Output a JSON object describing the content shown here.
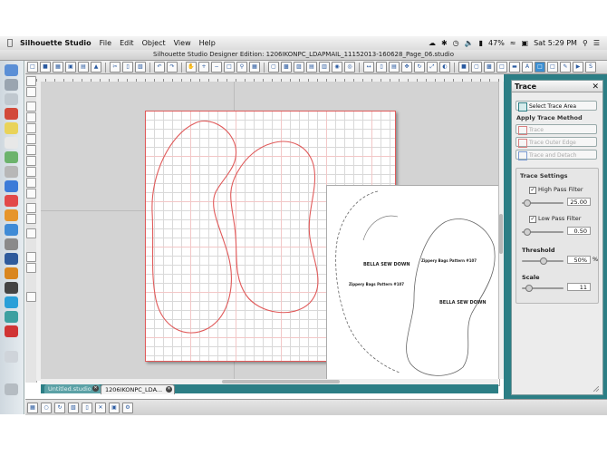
{
  "menubar": {
    "app_name": "Silhouette Studio",
    "menus": [
      "File",
      "Edit",
      "Object",
      "View",
      "Help"
    ],
    "battery": "47%",
    "clock": "Sat 5:29 PM"
  },
  "window": {
    "title": "Silhouette Studio Designer Edition: 1206IKONPC_LDAPMAIL_11152013-160628_Page_06.studio"
  },
  "tabs": [
    {
      "label": "Untitled.studio"
    },
    {
      "label": "1206IKONPC_LDA..."
    }
  ],
  "pattern_text": {
    "logo": "BELLA SEW DOWN",
    "pattern_a": "Zippery Bags Pattern #107",
    "pattern_b": "Zippery Bags Pattern #107"
  },
  "trace_panel": {
    "title": "Trace",
    "close_glyph": "✕",
    "select_area_label": "Select Trace Area",
    "apply_method_title": "Apply Trace Method",
    "methods": [
      "Trace",
      "Trace Outer Edge",
      "Trace and Detach"
    ],
    "settings_title": "Trace Settings",
    "high_pass_label": "High Pass Filter",
    "high_pass_value": "25.00",
    "low_pass_label": "Low Pass Filter",
    "low_pass_value": "0.50",
    "threshold_label": "Threshold",
    "threshold_value": "50%",
    "threshold_unit": "%",
    "scale_label": "Scale",
    "scale_value": "11"
  },
  "colors": {
    "teal": "#2c7e85",
    "accent": "#3d8fd1",
    "trace_red": "#e05a5a"
  }
}
